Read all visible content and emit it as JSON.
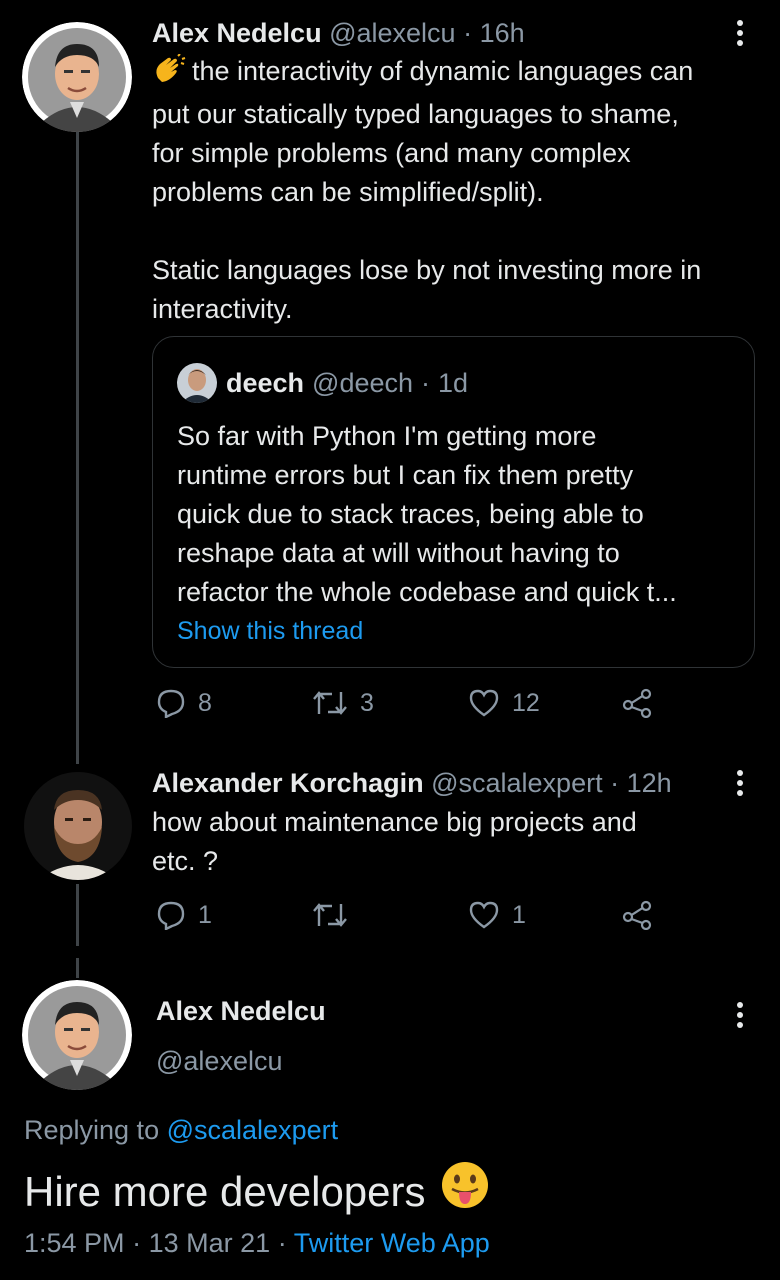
{
  "tweet1": {
    "name": "Alex Nedelcu",
    "handle": "@alexelcu",
    "sep": "·",
    "time": "16h",
    "emoji_name": "clapping-hands-emoji",
    "lines": [
      "the interactivity of dynamic languages can",
      "put our statically typed languages to shame,",
      "for simple problems (and many complex",
      "problems can be simplified/split).",
      "",
      "Static languages lose by not investing more in",
      "interactivity."
    ],
    "quote": {
      "name": "deech",
      "handle": "@deech",
      "sep": "·",
      "time": "1d",
      "lines": [
        "So far with Python I'm getting more",
        "runtime errors but I can fix them pretty",
        "quick due to stack traces, being able to",
        "reshape data at will without having to",
        "refactor the whole codebase and quick t..."
      ],
      "link": "Show this thread"
    },
    "replies": "8",
    "retweets": "3",
    "likes": "12"
  },
  "tweet2": {
    "name": "Alexander Korchagin",
    "handle": "@scalalexpert",
    "sep": "·",
    "time": "12h",
    "lines": [
      "how about maintenance big projects and",
      "etc. ?"
    ],
    "replies": "1",
    "retweets": "",
    "likes": "1"
  },
  "main": {
    "name": "Alex Nedelcu",
    "handle": "@alexelcu",
    "replying_prefix": "Replying to",
    "replying_to": "@scalalexpert",
    "text": "Hire more developers",
    "emoji_name": "tongue-out-emoji",
    "time": "1:54 PM",
    "sep1": "·",
    "date": "13 Mar 21",
    "sep2": "·",
    "source": "Twitter Web App"
  },
  "colors": {
    "background": "#000000",
    "text": "#e7e9ea",
    "muted": "#8b98a5",
    "link": "#1d9bf0",
    "border": "#2f3336"
  },
  "icons": [
    "reply-icon",
    "retweet-icon",
    "like-icon",
    "share-icon",
    "more-icon"
  ]
}
